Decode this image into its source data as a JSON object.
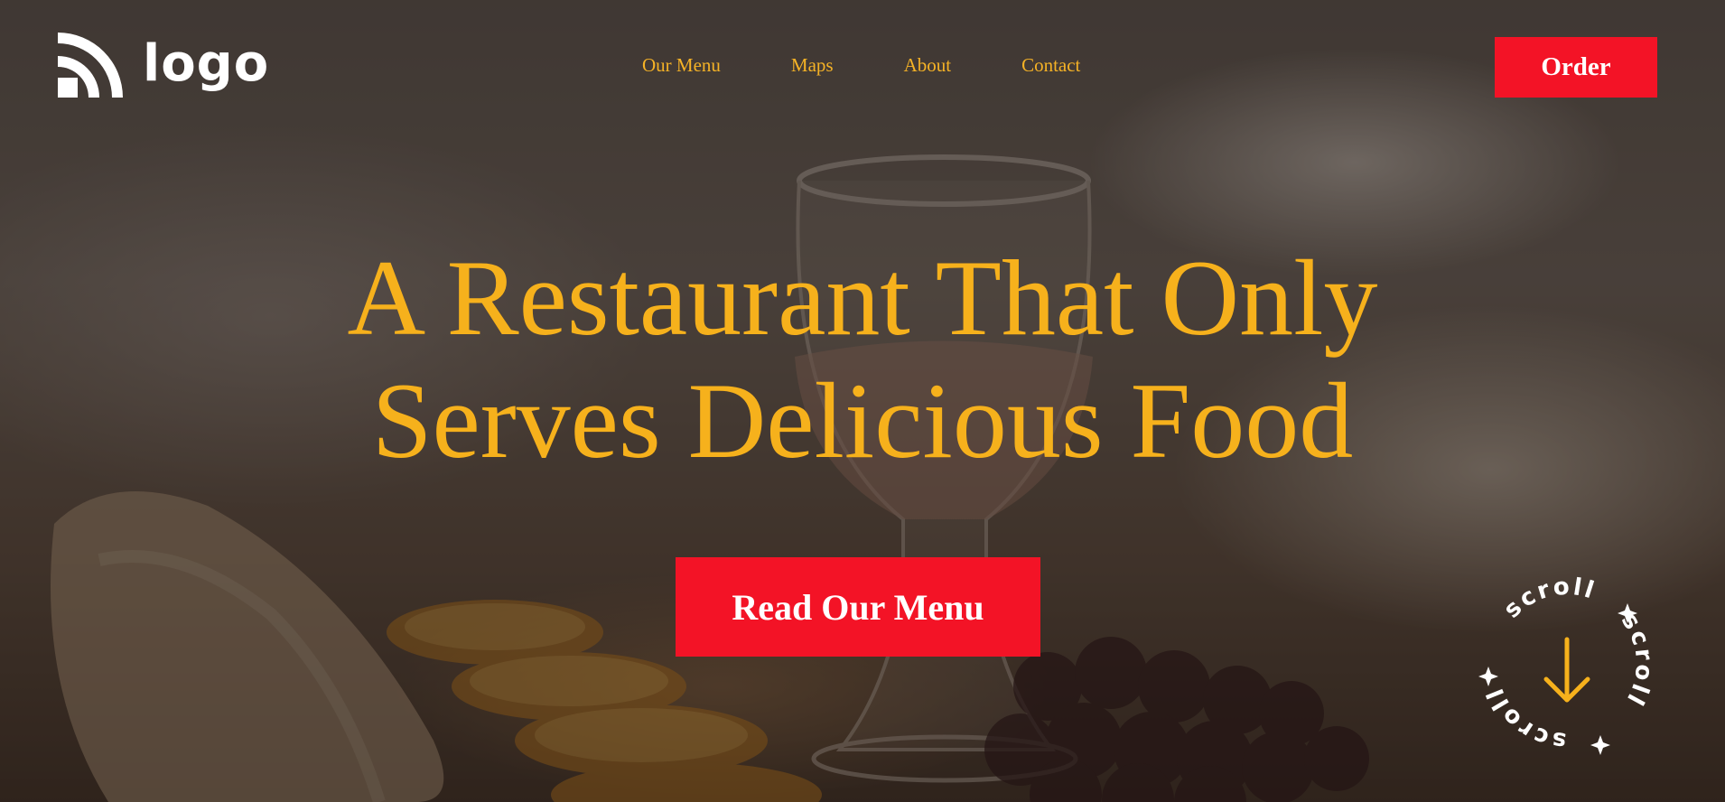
{
  "brand": {
    "logo_text": "logo",
    "logo_icon": "rss-arcs-icon"
  },
  "nav": {
    "items": [
      {
        "label": "Our Menu"
      },
      {
        "label": "Maps"
      },
      {
        "label": "About"
      },
      {
        "label": "Contact"
      }
    ]
  },
  "header": {
    "order_label": "Order"
  },
  "hero": {
    "title_line1": "A Restaurant That Only",
    "title_line2": "Serves Delicious Food",
    "cta_label": "Read Our Menu"
  },
  "scroll_badge": {
    "word": "scroll",
    "arrow_icon": "arrow-down-icon",
    "star_icon": "sparkle-icon"
  },
  "colors": {
    "accent_gold": "#f6b11c",
    "brand_red": "#f31326",
    "text_white": "#ffffff"
  }
}
